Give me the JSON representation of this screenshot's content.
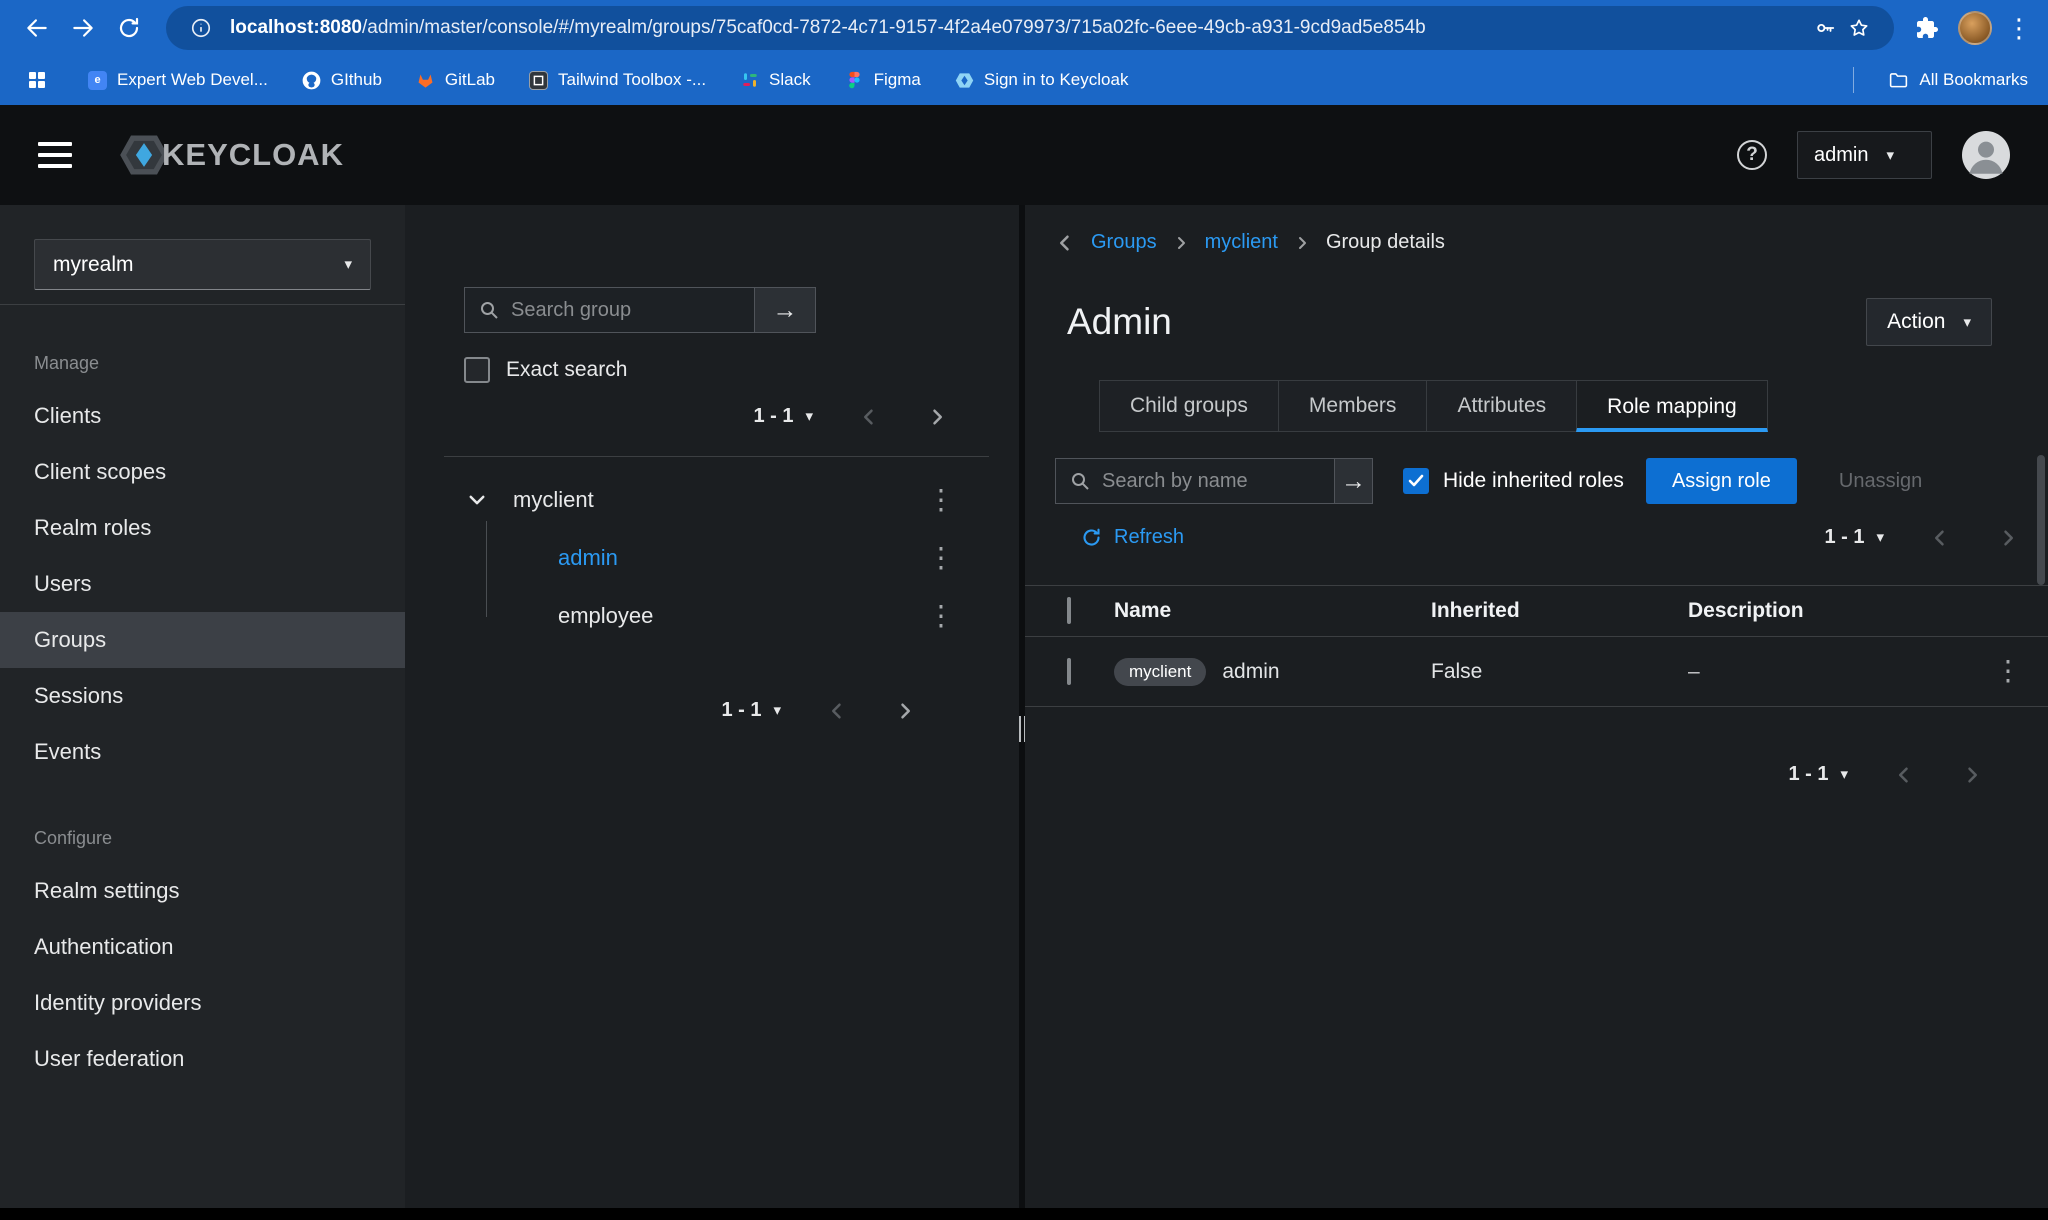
{
  "colors": {
    "chrome_bar": "#1b67c6",
    "omnibox": "#11509d",
    "masthead": "#0e1012",
    "sidebar": "#212427",
    "panel": "#1b1e21",
    "accent_link": "#2b9af3",
    "primary_button": "#0d6fd2",
    "selected_nav": "#3c4046"
  },
  "icons": {
    "caret_down": "▾",
    "kebab": "⋮",
    "submit_arrow": "→",
    "question": "?"
  },
  "browser": {
    "url_host": "localhost:8080",
    "url_path": "/admin/master/console/#/myrealm/groups/75caf0cd-7872-4c71-9157-4f2a4e079973/715a02fc-6eee-49cb-a931-9cd9ad5e854b",
    "bookmarks": [
      {
        "label": "Expert Web Devel...",
        "icon": "code-favicon"
      },
      {
        "label": "GIthub",
        "icon": "github-favicon"
      },
      {
        "label": "GitLab",
        "icon": "gitlab-favicon"
      },
      {
        "label": "Tailwind Toolbox -...",
        "icon": "tailwind-favicon"
      },
      {
        "label": "Slack",
        "icon": "slack-favicon"
      },
      {
        "label": "Figma",
        "icon": "figma-favicon"
      },
      {
        "label": "Sign in to Keycloak",
        "icon": "keycloak-favicon"
      }
    ],
    "all_bookmarks": "All Bookmarks",
    "favicon_code_glyph": "e"
  },
  "masthead": {
    "brand": "KEYCLOAK",
    "user_menu": "admin"
  },
  "sidebar": {
    "realm_select": "myrealm",
    "sections": [
      {
        "label": "Manage",
        "items": [
          "Clients",
          "Client scopes",
          "Realm roles",
          "Users",
          "Groups",
          "Sessions",
          "Events"
        ]
      },
      {
        "label": "Configure",
        "items": [
          "Realm settings",
          "Authentication",
          "Identity providers",
          "User federation"
        ]
      }
    ],
    "selected_item": "Groups"
  },
  "groups_panel": {
    "search_placeholder": "Search group",
    "exact_search_label": "Exact search",
    "pagination_top": "1 - 1",
    "pagination_bottom": "1 - 1",
    "tree_root": "myclient",
    "tree_children": [
      "admin",
      "employee"
    ],
    "selected_child": "admin"
  },
  "main": {
    "breadcrumb": [
      "Groups",
      "myclient",
      "Group details"
    ],
    "title": "Admin",
    "action_button": "Action",
    "tabs": [
      "Child groups",
      "Members",
      "Attributes",
      "Role mapping"
    ],
    "active_tab": "Role mapping",
    "toolbar": {
      "search_placeholder": "Search by name",
      "hide_inherited_label": "Hide inherited roles",
      "assign_role_button": "Assign role",
      "unassign_button": "Unassign",
      "refresh_label": "Refresh",
      "pagination": "1 - 1"
    },
    "table": {
      "columns": [
        "Name",
        "Inherited",
        "Description"
      ],
      "rows": [
        {
          "client_badge": "myclient",
          "name": "admin",
          "inherited": "False",
          "description": "–"
        }
      ]
    },
    "pagination_bottom": "1 - 1"
  }
}
